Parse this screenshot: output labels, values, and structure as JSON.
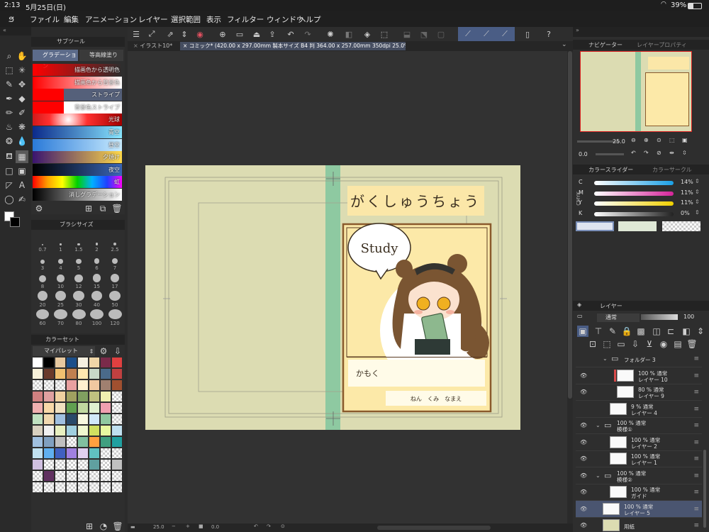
{
  "status": {
    "time": "2:13",
    "date": "5月25日(日)",
    "battery": "39%"
  },
  "menu": [
    "ファイル",
    "編集",
    "アニメーション",
    "レイヤー",
    "選択範囲",
    "表示",
    "フィルター",
    "ウィンドウ",
    "ヘルプ"
  ],
  "tabs": [
    {
      "label": "イラスト10*"
    },
    {
      "label": "コミック* (420.00 x 297.00mm 製本サイズ B4 判 364.00 x 257.00mm 350dpi 25.0%)"
    }
  ],
  "subtool": {
    "title": "サブツール",
    "tab_active": "グラデーション",
    "tab_other": "等高線塗り",
    "gradients": [
      {
        "label": "描画色から透明色",
        "colors": [
          "#ff0000",
          "#ff000000"
        ]
      },
      {
        "label": "描画色から背景色",
        "colors": [
          "#ff0000",
          "#ffffff"
        ]
      },
      {
        "label": "ストライプ",
        "colors": [
          "#ff0000",
          "#ff0000"
        ]
      },
      {
        "label": "背景色ストライプ",
        "colors": [
          "#ff0000",
          "#ffffff"
        ]
      },
      {
        "label": "光球",
        "colors": [
          "#ff1a1a",
          "#ffffff"
        ]
      },
      {
        "label": "青空",
        "colors": [
          "#0b2a8a",
          "#88e6ff"
        ]
      },
      {
        "label": "昼空",
        "colors": [
          "#2a7ad8",
          "#c9ecff"
        ]
      },
      {
        "label": "夕焼け",
        "colors": [
          "#3a1470",
          "#ffd94a"
        ]
      },
      {
        "label": "夜空",
        "colors": [
          "#000000",
          "#3a66b8"
        ]
      },
      {
        "label": "虹",
        "colors": [
          "#ff0000",
          "#ff00ff"
        ]
      },
      {
        "label": "消しグラデーション",
        "colors": [
          "#000000",
          "#ffffff"
        ]
      }
    ]
  },
  "brushsize": {
    "title": "ブラシサイズ",
    "sizes": [
      "0.7",
      "1",
      "1.5",
      "2",
      "2.5",
      "3",
      "4",
      "5",
      "6",
      "7",
      "8",
      "10",
      "12",
      "15",
      "17",
      "20",
      "25",
      "30",
      "40",
      "50",
      "60",
      "70",
      "80",
      "100",
      "120"
    ]
  },
  "colorset": {
    "title": "カラーセット",
    "palette_name": "マイパレット"
  },
  "document": {
    "title": "がくしゅうちょう",
    "speech": "Study",
    "subject": "かもく",
    "name_line": "ねん　くみ　なまえ",
    "cover_bg": "#dcdcb2",
    "spine_color": "#8ec9a1",
    "frame_bg": "#fce9a8"
  },
  "navigator": {
    "title": "ナビゲーター",
    "tab2": "レイヤープロパティ",
    "zoom": "25.0",
    "angle": "0.0"
  },
  "colorslider": {
    "title": "カラースライダー",
    "tab2": "カラーサークル",
    "mode": "CMYK",
    "channels": [
      {
        "name": "C",
        "value": "14%",
        "color": "#1aa0e6"
      },
      {
        "name": "M",
        "value": "11%",
        "color": "#d6249a"
      },
      {
        "name": "Y",
        "value": "11%",
        "color": "#f0d000"
      },
      {
        "name": "K",
        "value": "0%",
        "color": "#222222"
      }
    ]
  },
  "layerpanel": {
    "title": "レイヤー",
    "blend": "通常",
    "opacity": "100",
    "layers": [
      {
        "name": "フォルダー 3",
        "info": "",
        "folder": true,
        "indent": 2,
        "eye": false
      },
      {
        "name": "レイヤー 10",
        "info": "100 %  通常",
        "indent": 3,
        "eye": true,
        "red": true
      },
      {
        "name": "レイヤー 9",
        "info": "80 %  通常",
        "indent": 3,
        "eye": true
      },
      {
        "name": "レイヤー 4",
        "info": "9 %  通常",
        "indent": 2,
        "eye": false
      },
      {
        "name": "模様①",
        "info": "100 %  通常",
        "folder": true,
        "indent": 1,
        "eye": true
      },
      {
        "name": "レイヤー 2",
        "info": "100 %  通常",
        "indent": 2,
        "eye": true
      },
      {
        "name": "レイヤー 1",
        "info": "100 %  通常",
        "indent": 2,
        "eye": true
      },
      {
        "name": "模様②",
        "info": "100 %  通常",
        "folder": true,
        "indent": 1,
        "eye": true
      },
      {
        "name": "ガイド",
        "info": "100 %  通常",
        "indent": 2,
        "eye": true
      },
      {
        "name": "レイヤー 5",
        "info": "100 %  通常",
        "indent": 1,
        "eye": true,
        "selected": true
      },
      {
        "name": "用紙",
        "info": "",
        "indent": 1,
        "eye": true,
        "paper": true
      }
    ]
  },
  "bottom": {
    "zoom": "25.0",
    "angle": "0.0"
  }
}
